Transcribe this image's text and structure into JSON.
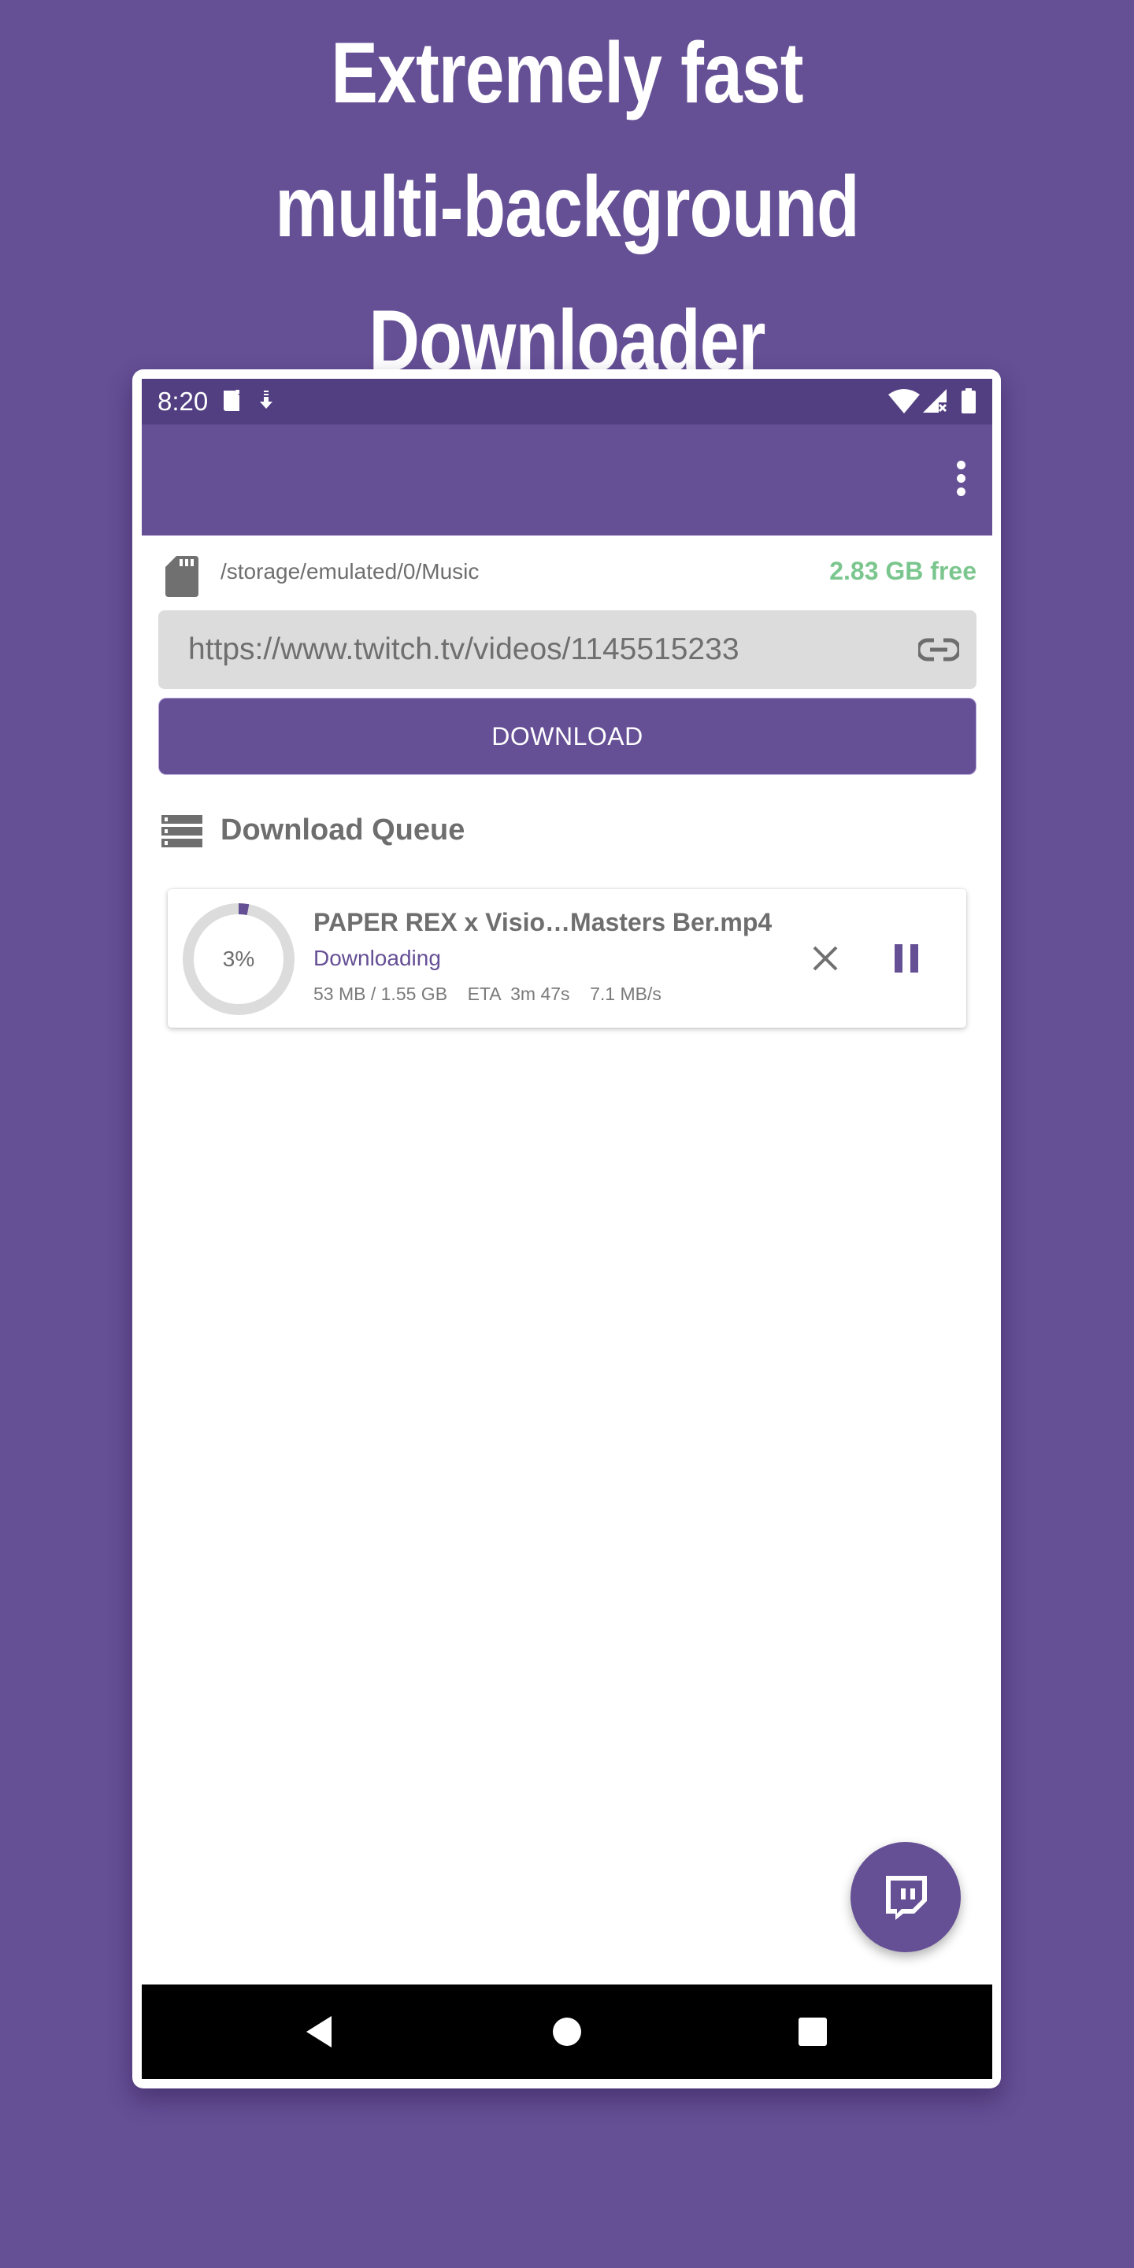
{
  "promo": {
    "headline_lines": [
      "Extremely fast",
      "multi-background",
      "Downloader"
    ]
  },
  "status_bar": {
    "time": "8:20",
    "left_icons": [
      "sd-card-notification-icon",
      "download-notification-icon"
    ],
    "right_icons": [
      "wifi-icon",
      "cellular-no-signal-icon",
      "battery-icon"
    ]
  },
  "toolbar": {
    "title": "",
    "overflow_icon": "more-vert-icon"
  },
  "storage": {
    "icon": "sd-card-icon",
    "path": "/storage/emulated/0/Music",
    "free_space": "2.83 GB free",
    "free_color": "#7bc68e"
  },
  "url_input": {
    "value": "https://www.twitch.tv/videos/1145515233",
    "placeholder": "",
    "icon": "link-icon"
  },
  "download_button": {
    "label": "DOWNLOAD"
  },
  "queue": {
    "icon": "list-icon",
    "title": "Download Queue",
    "items": [
      {
        "file_name": "PAPER REX x Visio…Masters Ber.mp4",
        "status": "Downloading",
        "progress_percent": 3,
        "progress_label": "3%",
        "meta": "53 MB / 1.55 GB    ETA  3m 47s    7.1 MB/s",
        "downloaded": "53 MB",
        "total": "1.55 GB",
        "eta": "3m 47s",
        "speed": "7.1 MB/s",
        "actions": [
          "cancel",
          "pause"
        ]
      }
    ]
  },
  "fab": {
    "icon": "twitch-icon"
  },
  "nav_bar": {
    "buttons": [
      "back",
      "home",
      "recents"
    ]
  },
  "colors": {
    "brand": "#654f95",
    "status_bar": "#523f81",
    "free_space": "#7bc68e",
    "ring_track": "#dcdcdc",
    "text_gray": "#6e6e6e"
  }
}
